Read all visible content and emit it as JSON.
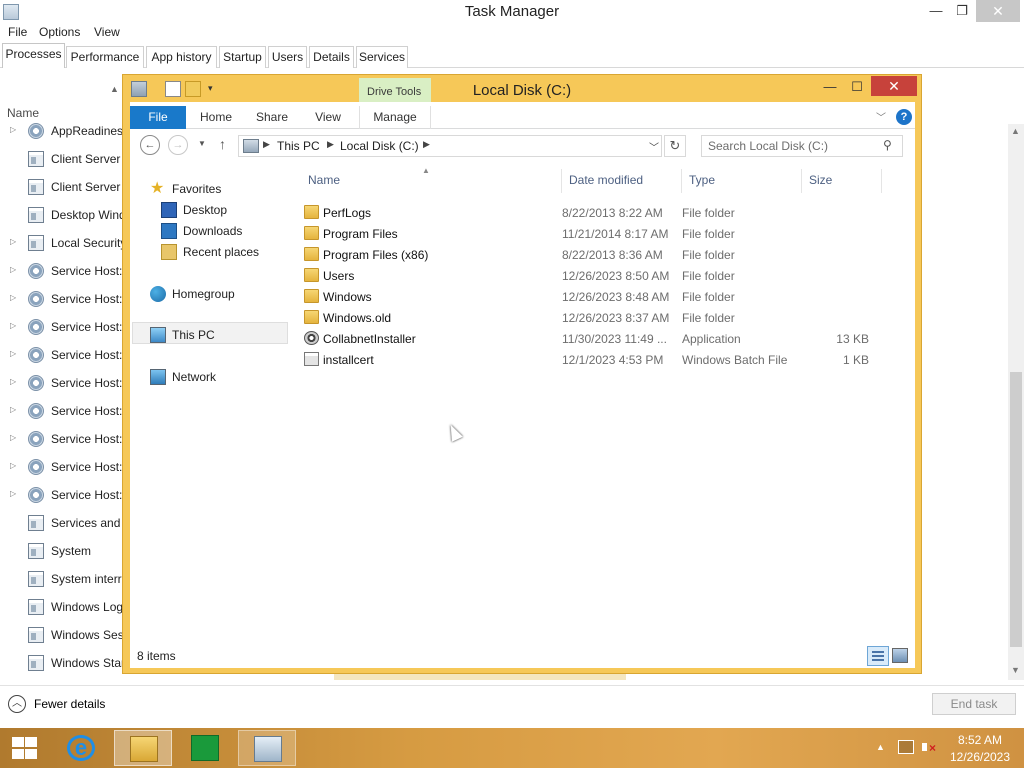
{
  "task_manager": {
    "title": "Task Manager",
    "menu": [
      "File",
      "Options",
      "View"
    ],
    "tabs": [
      {
        "label": "Processes",
        "active": true
      },
      {
        "label": "Performance"
      },
      {
        "label": "App history"
      },
      {
        "label": "Startup"
      },
      {
        "label": "Users"
      },
      {
        "label": "Details"
      },
      {
        "label": "Services"
      }
    ],
    "column_name": "Name",
    "processes": [
      {
        "name": "AppReadiness",
        "icon": "gear-icon",
        "expandable": true
      },
      {
        "name": "Client Server Runtime Process",
        "icon": "window-icon",
        "expandable": false
      },
      {
        "name": "Client Server Runtime Process",
        "icon": "window-icon",
        "expandable": false
      },
      {
        "name": "Desktop Window Manager",
        "icon": "window-icon",
        "expandable": false
      },
      {
        "name": "Local Security Authority Process",
        "icon": "window-icon",
        "expandable": true
      },
      {
        "name": "Service Host:",
        "icon": "gear-icon",
        "expandable": true
      },
      {
        "name": "Service Host:",
        "icon": "gear-icon",
        "expandable": true
      },
      {
        "name": "Service Host:",
        "icon": "gear-icon",
        "expandable": true
      },
      {
        "name": "Service Host:",
        "icon": "gear-icon",
        "expandable": true
      },
      {
        "name": "Service Host:",
        "icon": "gear-icon",
        "expandable": true
      },
      {
        "name": "Service Host:",
        "icon": "gear-icon",
        "expandable": true
      },
      {
        "name": "Service Host:",
        "icon": "gear-icon",
        "expandable": true
      },
      {
        "name": "Service Host:",
        "icon": "gear-icon",
        "expandable": true
      },
      {
        "name": "Service Host:",
        "icon": "gear-icon",
        "expandable": true
      },
      {
        "name": "Services and Controller app",
        "icon": "window-icon",
        "expandable": false
      },
      {
        "name": "System",
        "icon": "window-icon",
        "expandable": false
      },
      {
        "name": "System interrupts",
        "icon": "window-icon",
        "expandable": false
      },
      {
        "name": "Windows Logon Application",
        "icon": "window-icon",
        "expandable": false
      },
      {
        "name": "Windows Session Manager",
        "icon": "window-icon",
        "expandable": false
      },
      {
        "name": "Windows Start-Up Application",
        "icon": "window-icon",
        "expandable": false
      }
    ],
    "fewer_details": "Fewer details",
    "end_task": "End task"
  },
  "explorer": {
    "title": "Local Disk (C:)",
    "contextual_tab_group": "Drive Tools",
    "ribbon_tabs": [
      "File",
      "Home",
      "Share",
      "View",
      "Manage"
    ],
    "address": {
      "segments": [
        "This PC",
        "Local Disk (C:)"
      ]
    },
    "search": {
      "placeholder": "Search Local Disk (C:)"
    },
    "nav_pane": {
      "favorites": "Favorites",
      "favorites_items": [
        "Desktop",
        "Downloads",
        "Recent places"
      ],
      "homegroup": "Homegroup",
      "this_pc": "This PC",
      "network": "Network"
    },
    "columns": {
      "name": "Name",
      "date": "Date modified",
      "type": "Type",
      "size": "Size"
    },
    "files": [
      {
        "name": "PerfLogs",
        "date": "8/22/2013 8:22 AM",
        "type": "File folder",
        "size": "",
        "kind": "folder"
      },
      {
        "name": "Program Files",
        "date": "11/21/2014 8:17 AM",
        "type": "File folder",
        "size": "",
        "kind": "folder"
      },
      {
        "name": "Program Files (x86)",
        "date": "8/22/2013 8:36 AM",
        "type": "File folder",
        "size": "",
        "kind": "folder"
      },
      {
        "name": "Users",
        "date": "12/26/2023 8:50 AM",
        "type": "File folder",
        "size": "",
        "kind": "folder"
      },
      {
        "name": "Windows",
        "date": "12/26/2023 8:48 AM",
        "type": "File folder",
        "size": "",
        "kind": "folder"
      },
      {
        "name": "Windows.old",
        "date": "12/26/2023 8:37 AM",
        "type": "File folder",
        "size": "",
        "kind": "folder"
      },
      {
        "name": "CollabnetInstaller",
        "date": "11/30/2023 11:49 ...",
        "type": "Application",
        "size": "13 KB",
        "kind": "app"
      },
      {
        "name": "installcert",
        "date": "12/1/2023 4:53 PM",
        "type": "Windows Batch File",
        "size": "1 KB",
        "kind": "bat"
      }
    ],
    "status": {
      "item_count": "8 items"
    }
  },
  "taskbar": {
    "clock_time": "8:52 AM",
    "clock_date": "12/26/2023"
  },
  "colors": {
    "explorer_frame": "#f6c858",
    "file_tab": "#1979ca",
    "close_button": "#c7423b",
    "drive_tools": "#d9efc4"
  }
}
